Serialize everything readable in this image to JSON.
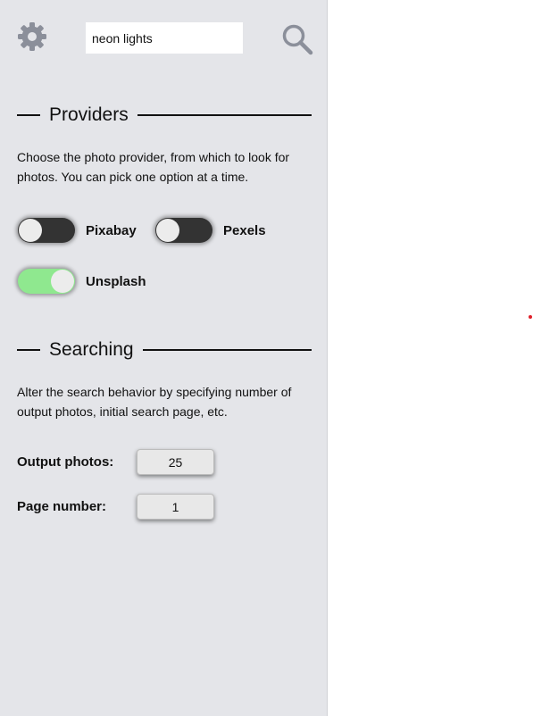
{
  "search": {
    "value": "neon lights"
  },
  "providers": {
    "title": "Providers",
    "description": "Choose the photo provider, from which to look for photos. You can pick one option at a time.",
    "options": [
      {
        "label": "Pixabay",
        "enabled": false
      },
      {
        "label": "Pexels",
        "enabled": false
      },
      {
        "label": "Unsplash",
        "enabled": true
      }
    ]
  },
  "searching": {
    "title": "Searching",
    "description": "Alter the search behavior by specifying number of output photos, initial search page, etc.",
    "output_photos": {
      "label": "Output photos:",
      "value": "25"
    },
    "page_number": {
      "label": "Page number:",
      "value": "1"
    }
  },
  "colors": {
    "panel_bg": "#e4e5e9",
    "toggle_on": "#8fe88f",
    "toggle_off": "#333333",
    "accent_dot": "#e0202a"
  },
  "icons": {
    "settings": "gear-icon",
    "search": "search-icon"
  }
}
